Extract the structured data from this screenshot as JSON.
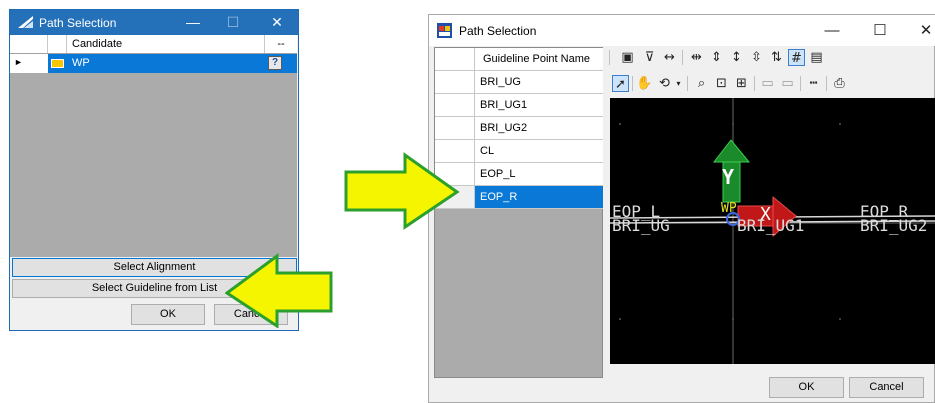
{
  "dialog_left": {
    "title": "Path Selection",
    "title_buttons": {
      "minimize": "—",
      "maximize": "☐",
      "close": "✕"
    },
    "grid": {
      "header": {
        "indicator": "",
        "icon": "",
        "candidate": "Candidate",
        "extra": "--"
      },
      "rows": [
        {
          "indicator": "►",
          "candidate": "WP",
          "extra_icon": "?"
        }
      ]
    },
    "buttons": {
      "select_alignment": "Select Alignment",
      "select_guideline": "Select Guideline from List",
      "ok": "OK",
      "cancel": "Cancel"
    }
  },
  "dialog_right": {
    "title": "Path Selection",
    "title_buttons": {
      "minimize": "—",
      "maximize": "☐",
      "close": "✕"
    },
    "list": {
      "header": "Guideline Point Name",
      "items": [
        "BRI_UG",
        "BRI_UG1",
        "BRI_UG2",
        "CL",
        "EOP_L",
        "EOP_R"
      ],
      "selected_index": 5,
      "selected_indicator": "▶"
    },
    "toolbar1_icons": [
      "fit-view-icon",
      "select-window-icon",
      "measure-distance-icon",
      "zoom-x-icon",
      "axis-y-icon",
      "axis-z-icon",
      "axis-ya-icon",
      "axis-za-icon",
      "grid-toggle-icon",
      "save-icon"
    ],
    "toolbar2_icons": [
      "pointer-icon",
      "pan-icon",
      "rotate-icon",
      "zoom-icon",
      "zoom-window-icon",
      "zoom-extents-icon",
      "view-1-icon",
      "view-2-icon",
      "ruler-icon",
      "print-icon"
    ],
    "viewport": {
      "labels": {
        "eop_l": "EOP_L",
        "bri_ug_left": "BRI_UG",
        "bri_ug1": "BRI_UG1",
        "eop_r": "EOP_R",
        "bri_ug2": "BRI_UG2",
        "wp": "WP",
        "y_axis": "Y",
        "x_axis": "X"
      },
      "colors": {
        "background": "#000000",
        "y_arrow": "#1a8a2a",
        "x_arrow": "#c01818",
        "origin": "#3a6ae0"
      }
    },
    "buttons": {
      "ok": "OK",
      "cancel": "Cancel"
    }
  },
  "annotations": {
    "arrow_color": "#f5f500",
    "arrow_border": "#2ca02c"
  }
}
